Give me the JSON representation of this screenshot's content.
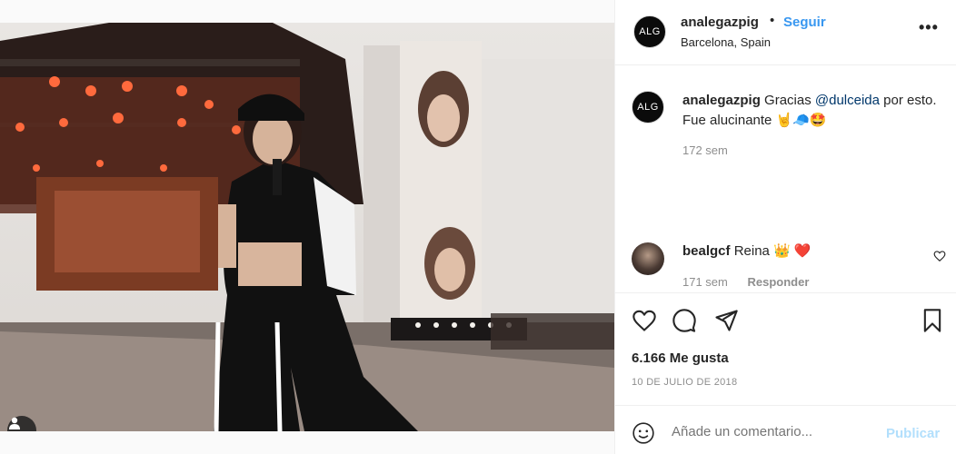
{
  "post": {
    "image_description_icon": "performer-on-stage-photo",
    "tag_icon": "user-tag-icon"
  },
  "header": {
    "avatar_text": "ALG",
    "username": "analegazpig",
    "separator": "•",
    "follow_label": "Seguir",
    "location": "Barcelona, Spain",
    "more_icon": "•••"
  },
  "caption": {
    "avatar_text": "ALG",
    "username": "analegazpig",
    "text_before": "Gracias ",
    "mention": "@dulceida",
    "text_after": " por esto. Fue alucinante 🤘🧢🤩",
    "time": "172 sem"
  },
  "comment": {
    "username": "bealgcf",
    "text": "Reina 👑 ❤️",
    "time": "171 sem",
    "reply_label": "Responder"
  },
  "stats": {
    "likes": "6.166 Me gusta",
    "date": "10 DE JULIO DE 2018"
  },
  "add_comment": {
    "placeholder": "Añade un comentario...",
    "publish_label": "Publicar"
  },
  "colors": {
    "accent": "#3897f0",
    "publish_disabled": "#b2dffc",
    "muted": "#8e8e8e"
  }
}
